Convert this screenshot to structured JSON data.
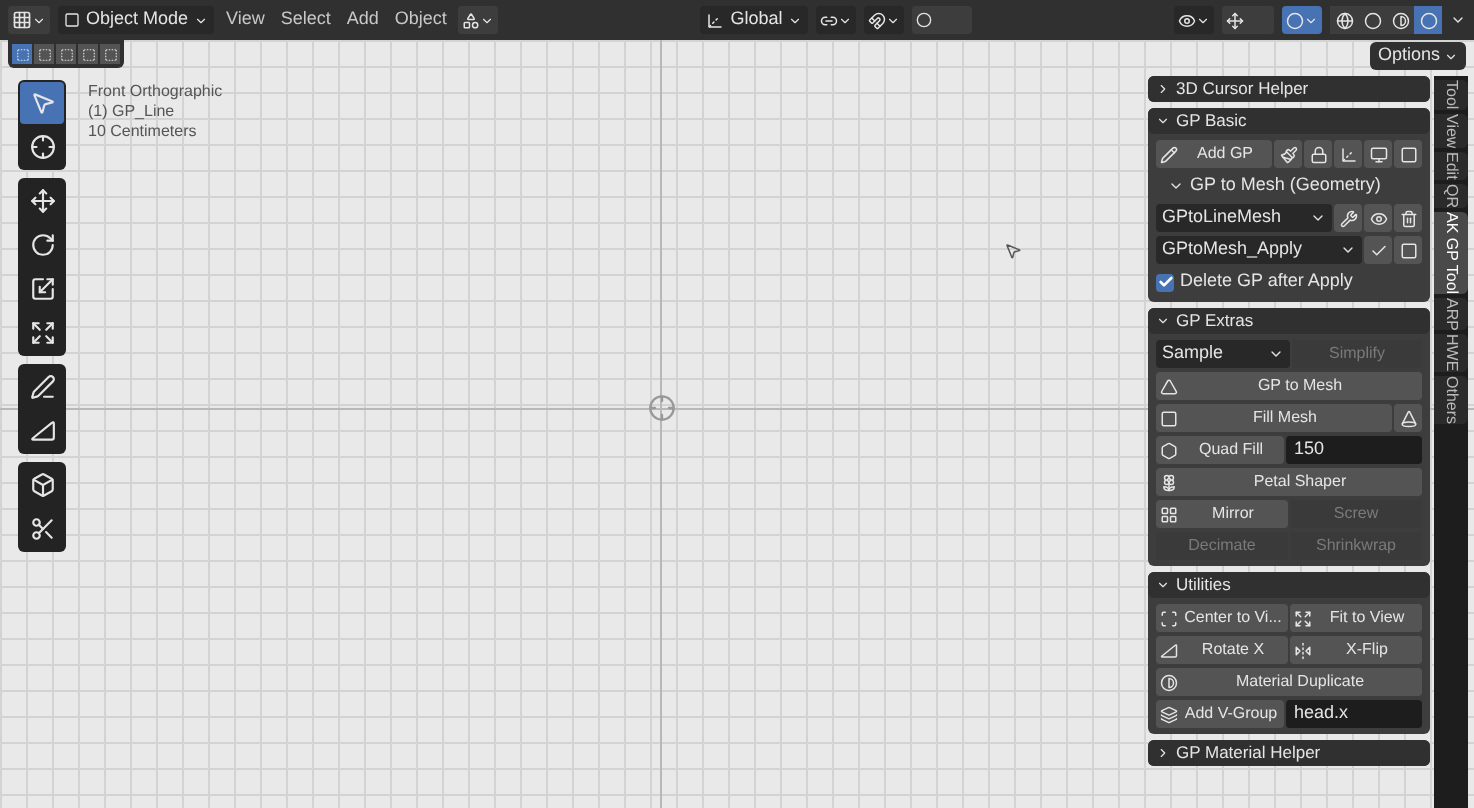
{
  "header": {
    "mode": "Object Mode",
    "menus": [
      "View",
      "Select",
      "Add",
      "Object"
    ],
    "transform_orientation": "Global",
    "shading": [
      {
        "selected": false
      },
      {
        "selected": false
      },
      {
        "selected": false
      },
      {
        "selected": true
      }
    ]
  },
  "select_modes": [
    {
      "selected": true
    },
    {
      "selected": false
    },
    {
      "selected": false
    },
    {
      "selected": false
    },
    {
      "selected": false
    }
  ],
  "viewport": {
    "info": [
      "Front Orthographic",
      "(1) GP_Line",
      "10 Centimeters"
    ],
    "options": "Options"
  },
  "toolbar": [
    [
      {
        "selected": true
      },
      {
        "selected": false
      }
    ],
    [
      {
        "selected": false
      },
      {
        "selected": false
      },
      {
        "selected": false
      },
      {
        "selected": false
      }
    ],
    [
      {
        "selected": false
      },
      {
        "selected": false
      }
    ],
    [
      {
        "selected": false
      },
      {
        "selected": false
      }
    ]
  ],
  "sidebar": {
    "tabs": [
      {
        "label": "Tool",
        "selected": false
      },
      {
        "label": "View",
        "selected": false
      },
      {
        "label": "Edit",
        "selected": false
      },
      {
        "label": "QR",
        "selected": false
      },
      {
        "label": "AK GP Tool",
        "selected": true
      },
      {
        "label": "ARP",
        "selected": false
      },
      {
        "label": "HWE",
        "selected": false
      },
      {
        "label": "Others",
        "selected": false
      }
    ],
    "panels": [
      {
        "title": "3D Cursor Helper",
        "expanded": false
      },
      {
        "title": "GP Basic",
        "expanded": true,
        "rows": [
          {
            "cells": [
              {
                "kind": "button",
                "label": "Add GP",
                "disabled": false
              },
              {
                "kind": "icon_button"
              },
              {
                "kind": "icon_button"
              },
              {
                "kind": "icon_button"
              },
              {
                "kind": "icon_button"
              },
              {
                "kind": "icon_button"
              }
            ]
          },
          {
            "cells": [
              {
                "kind": "subheader",
                "label": "GP to Mesh (Geometry)",
                "expanded": true
              }
            ]
          },
          {
            "cells": [
              {
                "kind": "dropdown",
                "label": "GPtoLineMesh"
              },
              {
                "kind": "icon_button"
              },
              {
                "kind": "icon_button"
              },
              {
                "kind": "icon_button"
              }
            ]
          },
          {
            "cells": [
              {
                "kind": "dropdown",
                "label": "GPtoMesh_Apply"
              },
              {
                "kind": "icon_button"
              },
              {
                "kind": "icon_button"
              }
            ]
          },
          {
            "cells": [
              {
                "kind": "checkbox",
                "label": "Delete GP after Apply",
                "checked": true
              }
            ]
          }
        ]
      },
      {
        "title": "GP Extras",
        "expanded": true,
        "rows": [
          {
            "cells": [
              {
                "kind": "dropdown",
                "label": "Sample"
              },
              {
                "kind": "button",
                "label": "Simplify",
                "disabled": true
              }
            ]
          },
          {
            "cells": [
              {
                "kind": "button",
                "label": "GP to Mesh",
                "disabled": false
              }
            ]
          },
          {
            "cells": [
              {
                "kind": "button",
                "label": "Fill Mesh",
                "disabled": false
              },
              {
                "kind": "icon_button"
              }
            ]
          },
          {
            "cells": [
              {
                "kind": "button",
                "label": "Quad Fill",
                "disabled": false
              },
              {
                "kind": "field",
                "label": "150"
              }
            ]
          },
          {
            "cells": [
              {
                "kind": "button",
                "label": "Petal Shaper",
                "disabled": false
              }
            ]
          },
          {
            "cells": [
              {
                "kind": "button",
                "label": "Mirror",
                "disabled": false
              },
              {
                "kind": "button",
                "label": "Screw",
                "disabled": true
              }
            ]
          },
          {
            "cells": [
              {
                "kind": "button",
                "label": "Decimate",
                "disabled": true
              },
              {
                "kind": "button",
                "label": "Shrinkwrap",
                "disabled": true
              }
            ]
          }
        ]
      },
      {
        "title": "Utilities",
        "expanded": true,
        "rows": [
          {
            "cells": [
              {
                "kind": "button",
                "label": "Center to Vi...",
                "disabled": false
              },
              {
                "kind": "button",
                "label": "Fit to View",
                "disabled": false
              }
            ]
          },
          {
            "cells": [
              {
                "kind": "button",
                "label": "Rotate X",
                "disabled": false
              },
              {
                "kind": "button",
                "label": "X-Flip",
                "disabled": false
              }
            ]
          },
          {
            "cells": [
              {
                "kind": "button",
                "label": "Material Duplicate",
                "disabled": false
              }
            ]
          },
          {
            "cells": [
              {
                "kind": "button",
                "label": "Add V-Group",
                "disabled": false
              },
              {
                "kind": "field",
                "label": "head.x"
              }
            ]
          }
        ]
      },
      {
        "title": "GP Material Helper",
        "expanded": false
      }
    ]
  }
}
